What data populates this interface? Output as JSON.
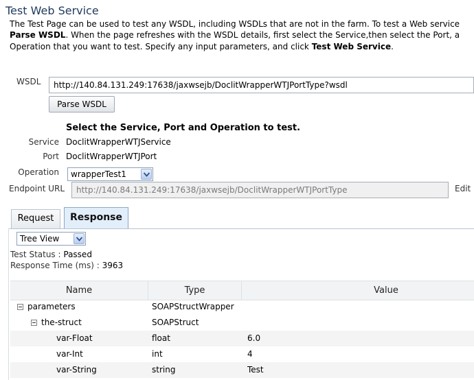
{
  "page": {
    "title": "Test Web Service",
    "intro": {
      "line1": "The Test Page can be used to test any WSDL, including WSDLs that are not in the farm. To test a Web service",
      "line2_bold1": "Parse WSDL",
      "line2_rest": ". When the page refreshes with the WSDL details, first select the Service,then select the Port, a",
      "line3_start": "Operation that you want to test. Specify any input parameters, and click ",
      "line3_bold": "Test Web Service",
      "line3_end": "."
    }
  },
  "wsdl": {
    "label": "WSDL",
    "value": "http://140.84.131.249:17638/jaxwsejb/DoclitWrapperWTJPortType?wsdl",
    "parse_button": "Parse WSDL"
  },
  "selection": {
    "heading": "Select the Service, Port and Operation to test.",
    "service_label": "Service",
    "service_value": "DoclitWrapperWTJService",
    "port_label": "Port",
    "port_value": "DoclitWrapperWTJPort",
    "operation_label": "Operation",
    "operation_value": "wrapperTest1",
    "endpoint_label": "Endpoint URL",
    "endpoint_value": "http://140.84.131.249:17638/jaxwsejb/DoclitWrapperWTJPortType",
    "edit_label": "Edit"
  },
  "tabs": {
    "request": "Request",
    "response": "Response"
  },
  "response": {
    "view_select": "Tree View",
    "test_status_label": "Test Status :",
    "test_status_value": "Passed",
    "response_time_label": "Response Time (ms) :",
    "response_time_value": "3963"
  },
  "grid": {
    "columns": [
      "Name",
      "Type",
      "Value"
    ],
    "rows": [
      {
        "name": "parameters",
        "type": "SOAPStructWrapper",
        "value": ""
      },
      {
        "name": "the-struct",
        "type": "SOAPStruct",
        "value": ""
      },
      {
        "name": "var-Float",
        "type": "float",
        "value": "6.0"
      },
      {
        "name": "var-Int",
        "type": "int",
        "value": "4"
      },
      {
        "name": "var-String",
        "type": "string",
        "value": "Test"
      }
    ]
  },
  "colors": {
    "title": "#1f3a5c",
    "active_tab_bg": "#e3eefb",
    "grid_header_bg": "#f1f3f5"
  },
  "icons": {
    "dropdown": "chevron-down-icon",
    "tree_toggle": "collapse-minus-icon"
  }
}
